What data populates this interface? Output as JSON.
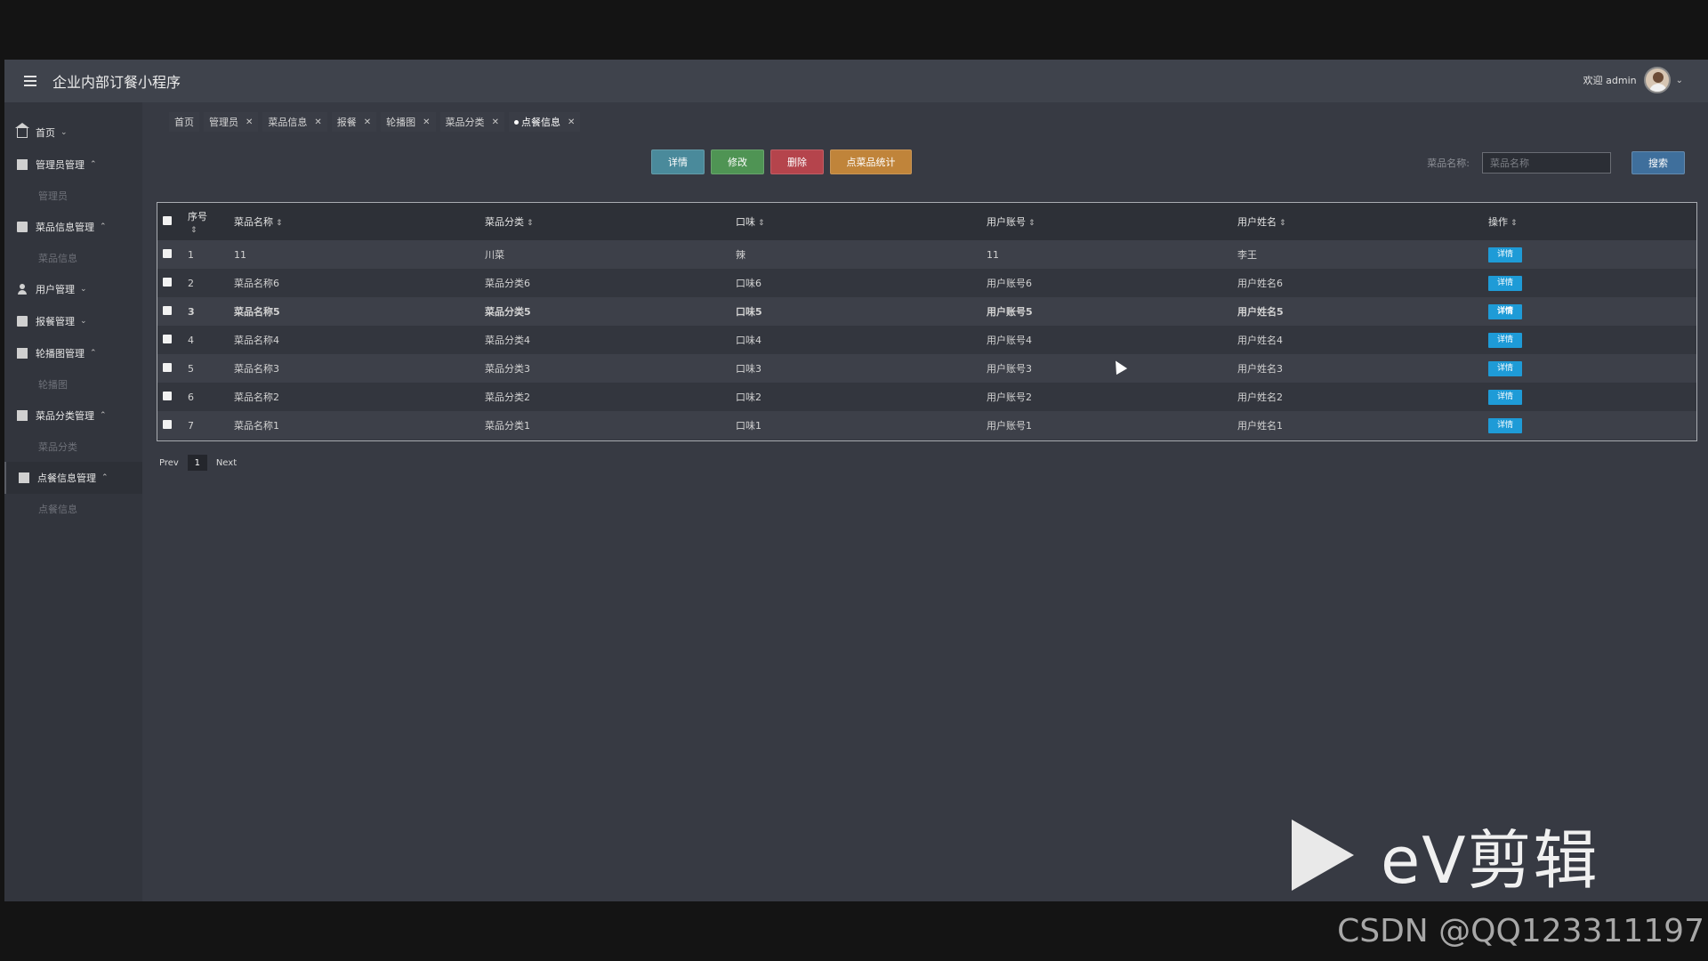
{
  "header": {
    "menu_icon": "hamburger-icon",
    "title": "企业内部订餐小程序",
    "welcome": "欢迎 admin",
    "avatar_icon": "user-avatar"
  },
  "sidebar": {
    "items": [
      {
        "label": "首页",
        "icon": "home-icon",
        "arrow": "⌄",
        "sub": []
      },
      {
        "label": "管理员管理",
        "icon": "dashboard-icon",
        "arrow": "⌃",
        "sub": [
          "管理员"
        ]
      },
      {
        "label": "菜品信息管理",
        "icon": "book-icon",
        "arrow": "⌃",
        "sub": [
          "菜品信息"
        ]
      },
      {
        "label": "用户管理",
        "icon": "user-icon",
        "arrow": "⌄",
        "sub": []
      },
      {
        "label": "报餐管理",
        "icon": "gift-icon",
        "arrow": "⌄",
        "sub": []
      },
      {
        "label": "轮播图管理",
        "icon": "table-icon",
        "arrow": "⌃",
        "sub": [
          "轮播图"
        ]
      },
      {
        "label": "菜品分类管理",
        "icon": "table-icon",
        "arrow": "⌃",
        "sub": [
          "菜品分类"
        ]
      },
      {
        "label": "点餐信息管理",
        "icon": "doc-icon",
        "arrow": "⌃",
        "sub": [
          "点餐信息"
        ]
      }
    ]
  },
  "tabs": [
    {
      "label": "首页",
      "closable": false,
      "active": false
    },
    {
      "label": "管理员",
      "closable": true,
      "active": false
    },
    {
      "label": "菜品信息",
      "closable": true,
      "active": false
    },
    {
      "label": "报餐",
      "closable": true,
      "active": false
    },
    {
      "label": "轮播图",
      "closable": true,
      "active": false
    },
    {
      "label": "菜品分类",
      "closable": true,
      "active": false
    },
    {
      "label": "点餐信息",
      "closable": true,
      "active": true
    }
  ],
  "toolbar": {
    "detail_label": "详情",
    "edit_label": "修改",
    "delete_label": "删除",
    "stats_label": "点菜品统计"
  },
  "search": {
    "label": "菜品名称:",
    "placeholder": "菜品名称",
    "button_label": "搜索"
  },
  "table": {
    "columns": [
      "序号",
      "菜品名称",
      "菜品分类",
      "口味",
      "用户账号",
      "用户姓名",
      "操作"
    ],
    "rows": [
      {
        "no": "1",
        "name": "11",
        "category": "川菜",
        "taste": "辣",
        "account": "11",
        "username": "李王"
      },
      {
        "no": "2",
        "name": "菜品名称6",
        "category": "菜品分类6",
        "taste": "口味6",
        "account": "用户账号6",
        "username": "用户姓名6"
      },
      {
        "no": "3",
        "name": "菜品名称5",
        "category": "菜品分类5",
        "taste": "口味5",
        "account": "用户账号5",
        "username": "用户姓名5"
      },
      {
        "no": "4",
        "name": "菜品名称4",
        "category": "菜品分类4",
        "taste": "口味4",
        "account": "用户账号4",
        "username": "用户姓名4"
      },
      {
        "no": "5",
        "name": "菜品名称3",
        "category": "菜品分类3",
        "taste": "口味3",
        "account": "用户账号3",
        "username": "用户姓名3"
      },
      {
        "no": "6",
        "name": "菜品名称2",
        "category": "菜品分类2",
        "taste": "口味2",
        "account": "用户账号2",
        "username": "用户姓名2"
      },
      {
        "no": "7",
        "name": "菜品名称1",
        "category": "菜品分类1",
        "taste": "口味1",
        "account": "用户账号1",
        "username": "用户姓名1"
      }
    ],
    "row_action_label": "详情"
  },
  "pager": {
    "prev": "Prev",
    "current": "1",
    "next": "Next"
  },
  "watermark": {
    "text": "eV剪辑",
    "credit": "CSDN @QQ123311197"
  }
}
